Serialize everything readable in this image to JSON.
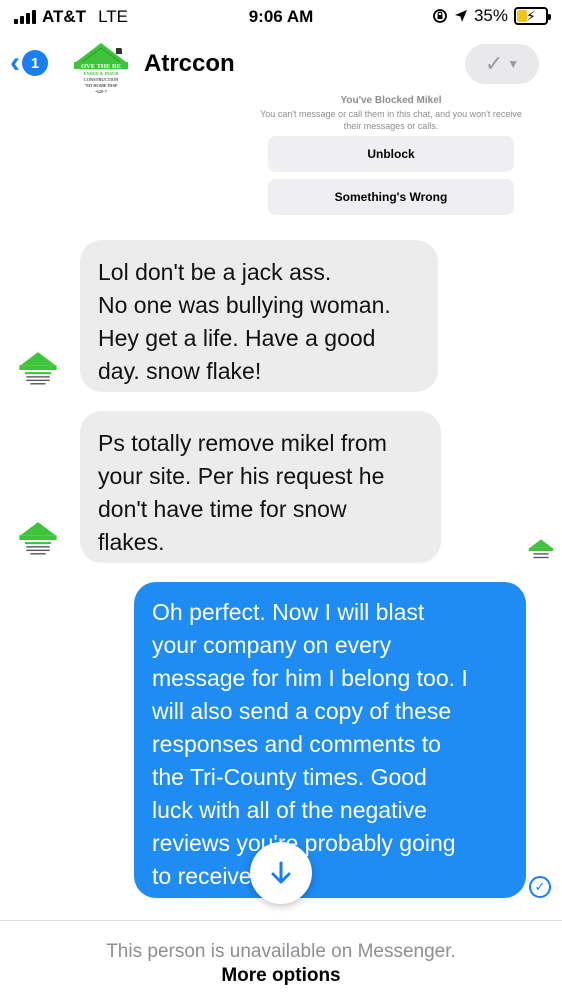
{
  "status_bar": {
    "carrier": "AT&T",
    "network": "LTE",
    "time": "9:06 AM",
    "battery_percent": "35%",
    "battery_level": 0.35,
    "icons": [
      "signal-bars-icon",
      "screen-rotation-lock-icon",
      "location-arrow-icon",
      "battery-charging-icon"
    ]
  },
  "header": {
    "back_badge": "1",
    "contact_name": "Atrccon",
    "avatar_text": {
      "line1": "OVE THE RE",
      "line2": "ENSED & INSUR",
      "line3": "CONSTRUCTION",
      "line4": "\"ED HOME INSP",
      "line5": "-620-7"
    }
  },
  "blocked_notice": {
    "title": "You've Blocked Mikel",
    "subtitle": "You can't message or call them in this chat, and you won't receive their messages or calls.",
    "unblock_label": "Unblock",
    "something_wrong_label": "Something's Wrong"
  },
  "messages": [
    {
      "direction": "incoming",
      "lines": [
        "Lol don't be a jack ass.",
        "No one was bullying woman.",
        "Hey get a life. Have a good",
        "day. snow flake!"
      ]
    },
    {
      "direction": "incoming",
      "lines": [
        "Ps totally remove mikel from",
        "your site. Per his request he",
        "don't have time for snow",
        "flakes."
      ]
    },
    {
      "direction": "outgoing",
      "lines": [
        "Oh perfect. Now I will blast",
        "your company on every",
        "message for him I belong too. I",
        "will also send a copy of these",
        "responses and comments to",
        "the Tri-County times. Good",
        "luck with all of the negative",
        "reviews you're probably going",
        "to receive"
      ]
    }
  ],
  "footer": {
    "unavailable_text": "This person is unavailable on Messenger.",
    "more_options_label": "More options"
  },
  "colors": {
    "accent": "#1a7ff2",
    "outgoing_bubble": "#1e8cf3",
    "incoming_bubble": "#ececed",
    "logo_green": "#3ec43a"
  }
}
